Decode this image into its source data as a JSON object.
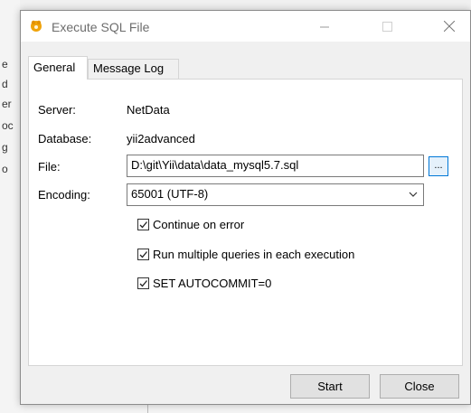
{
  "window": {
    "title": "Execute SQL File",
    "accent_color": "#0078d7"
  },
  "background": {
    "fragments": [
      "e",
      "d",
      "er",
      "oc",
      "g",
      "o"
    ]
  },
  "tabs": [
    {
      "label": "General",
      "selected": true
    },
    {
      "label": "Message Log",
      "selected": false
    }
  ],
  "general": {
    "server_label": "Server:",
    "server_value": "NetData",
    "database_label": "Database:",
    "database_value": "yii2advanced",
    "file_label": "File:",
    "file_value": "D:\\git\\Yii\\data\\data_mysql5.7.sql",
    "browse_label": "...",
    "encoding_label": "Encoding:",
    "encoding_value": "65001 (UTF-8)",
    "options": [
      {
        "label": "Continue on error",
        "checked": true
      },
      {
        "label": "Run multiple queries in each execution",
        "checked": true
      },
      {
        "label": "SET AUTOCOMMIT=0",
        "checked": true
      }
    ]
  },
  "buttons": {
    "start_label": "Start",
    "close_label": "Close"
  }
}
